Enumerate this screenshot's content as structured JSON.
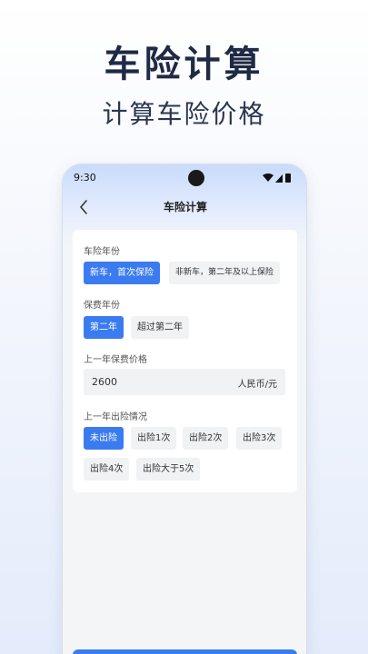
{
  "hero": {
    "title": "车险计算",
    "subtitle": "计算车险价格"
  },
  "status_bar": {
    "time": "9:30",
    "icons": [
      "wifi-icon",
      "signal-icon",
      "battery-icon"
    ]
  },
  "nav": {
    "title": "车险计算",
    "back_icon": "chevron-left-icon"
  },
  "form": {
    "insurance_year": {
      "label": "车险年份",
      "options": [
        "新车，首次保险",
        "非新车，第二年及以上保险"
      ],
      "selected": 0
    },
    "premium_year": {
      "label": "保费年份",
      "options": [
        "第二年",
        "超过第二年"
      ],
      "selected": 0
    },
    "last_year_price": {
      "label": "上一年保费价格",
      "value": "2600",
      "unit": "人民币/元"
    },
    "claims": {
      "label": "上一年出险情况",
      "options": [
        "未出险",
        "出险1次",
        "出险2次",
        "出险3次",
        "出险4次",
        "出险大于5次"
      ],
      "selected": 0
    }
  },
  "colors": {
    "accent": "#3a7bf0",
    "hero_text": "#1f2a44",
    "chip_bg": "#f1f2f4"
  }
}
